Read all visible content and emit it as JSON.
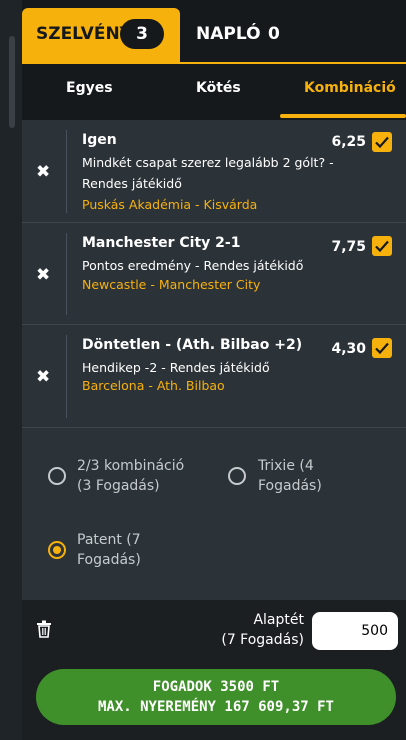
{
  "tabs": {
    "szelveny": {
      "label": "SZELVÉNY",
      "count": "3"
    },
    "naplo": {
      "label": "NAPLÓ",
      "count": "0"
    }
  },
  "subtabs": [
    {
      "label": "Egyes",
      "active": false
    },
    {
      "label": "Kötés",
      "active": false
    },
    {
      "label": "Kombináció",
      "active": true
    }
  ],
  "bets": [
    {
      "title": "Igen",
      "description": "Mindkét csapat szerez legalább 2 gólt? - Rendes játékidő",
      "teams": "Puskás Akadémia - Kisvárda",
      "odds": "6,25",
      "checked": true
    },
    {
      "title": "Manchester City 2-1",
      "description": "Pontos eredmény - Rendes játékidő",
      "teams": "Newcastle - Manchester City",
      "odds": "7,75",
      "checked": true
    },
    {
      "title": "Döntetlen - (Ath. Bilbao +2)",
      "description": "Hendikep -2 - Rendes játékidő",
      "teams": "Barcelona - Ath. Bilbao",
      "odds": "4,30",
      "checked": true
    }
  ],
  "options": [
    {
      "line1": "2/3 kombináció",
      "line2": "(3 Fogadás)",
      "selected": false
    },
    {
      "line1": "Trixie (4",
      "line2": "Fogadás)",
      "selected": false
    },
    {
      "line1": "Patent (7",
      "line2": "Fogadás)",
      "selected": true
    }
  ],
  "stake": {
    "label_line1": "Alaptét",
    "label_line2": "(7 Fogadás)",
    "value": "500"
  },
  "place_button": {
    "line1": "FOGADOK 3500 FT",
    "line2": "MAX. NYEREMÉNY 167 609,37 FT"
  },
  "colors": {
    "accent": "#f7b10c",
    "panel": "#2c3338",
    "dark": "#15191c",
    "button": "#3f8f2a"
  }
}
